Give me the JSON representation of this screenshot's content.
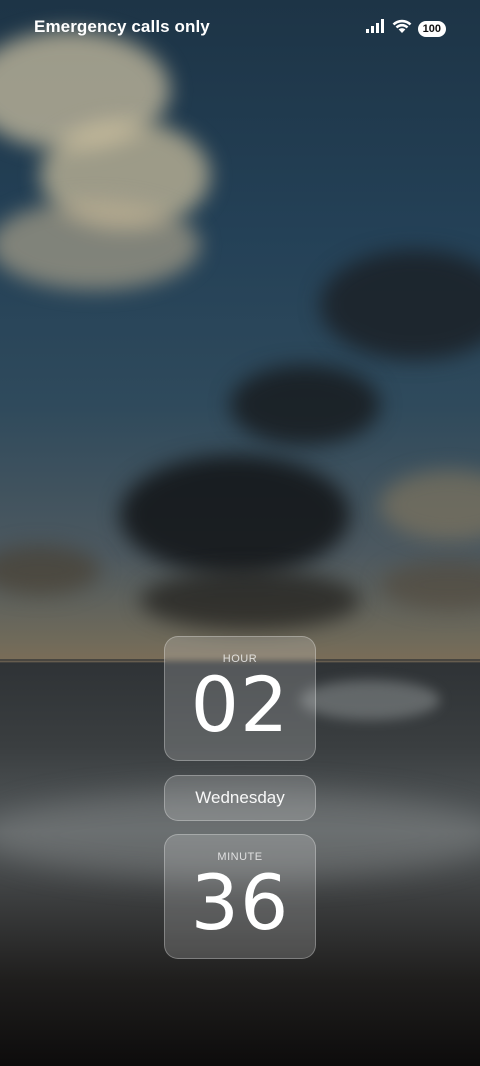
{
  "status_bar": {
    "carrier_text": "Emergency calls only",
    "battery_level": "100",
    "signal_icon": "signal-bars-icon",
    "wifi_icon": "wifi-icon"
  },
  "clock_widget": {
    "hour_label": "HOUR",
    "hour_value": "02",
    "day": "Wednesday",
    "minute_label": "MINUTE",
    "minute_value": "36"
  },
  "wallpaper": {
    "description_colors": {
      "sky_top": "#1d3446",
      "horizon_glow": "#7a6d58",
      "sea": "#3a3e40",
      "sand": "#0d0c0c"
    }
  }
}
